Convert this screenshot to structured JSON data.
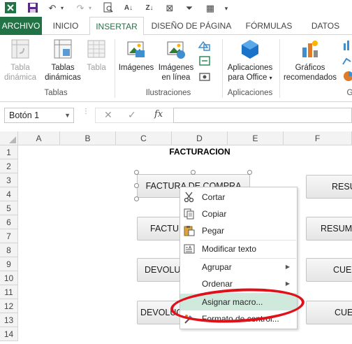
{
  "ribbon_tabs": {
    "file": "ARCHIVO",
    "home": "INICIO",
    "insert": "INSERTAR",
    "page_layout": "DISEÑO DE PÁGINA",
    "formulas": "FÓRMULAS",
    "data": "DATOS"
  },
  "ribbon": {
    "pivot_table": [
      "Tabla",
      "dinámica"
    ],
    "recommended_pivot": [
      "Tablas",
      "dinámicas"
    ],
    "table": "Tabla",
    "tables_group": "Tablas",
    "images": "Imágenes",
    "online_images": [
      "Imágenes",
      "en línea"
    ],
    "illustrations_group": "Ilustraciones",
    "office_apps": [
      "Aplicaciones",
      "para Office"
    ],
    "apps_group": "Aplicaciones",
    "recommended_charts": [
      "Gráficos",
      "recomendados"
    ],
    "charts_group_partial": "G"
  },
  "formula_bar": {
    "name_box": "Botón 1",
    "fx": "fx"
  },
  "columns": [
    "A",
    "B",
    "C",
    "D",
    "E",
    "F"
  ],
  "rows": [
    "1",
    "2",
    "3",
    "4",
    "5",
    "6",
    "7",
    "8",
    "9",
    "10",
    "11",
    "12",
    "13",
    "14"
  ],
  "sheet": {
    "title": "FACTURACION",
    "buttons": {
      "factura_compra": "FACTURA DE COMPRA",
      "factu": "FACTU",
      "devolu1": "DEVOLU",
      "devoluc2": "DEVOLUC",
      "resu": "RESU",
      "resum": "RESUM",
      "cuen": "CUEN",
      "cue": "CUE"
    }
  },
  "context_menu": {
    "cut": "Cortar",
    "copy": "Copiar",
    "paste": "Pegar",
    "edit_text": "Modificar texto",
    "group": "Agrupar",
    "order": "Ordenar",
    "assign_macro": "Asignar macro...",
    "format_control": "Formato de control..."
  },
  "colors": {
    "excel_green": "#217346",
    "highlight": "#cfeadc",
    "annotation_red": "#e0101a"
  }
}
